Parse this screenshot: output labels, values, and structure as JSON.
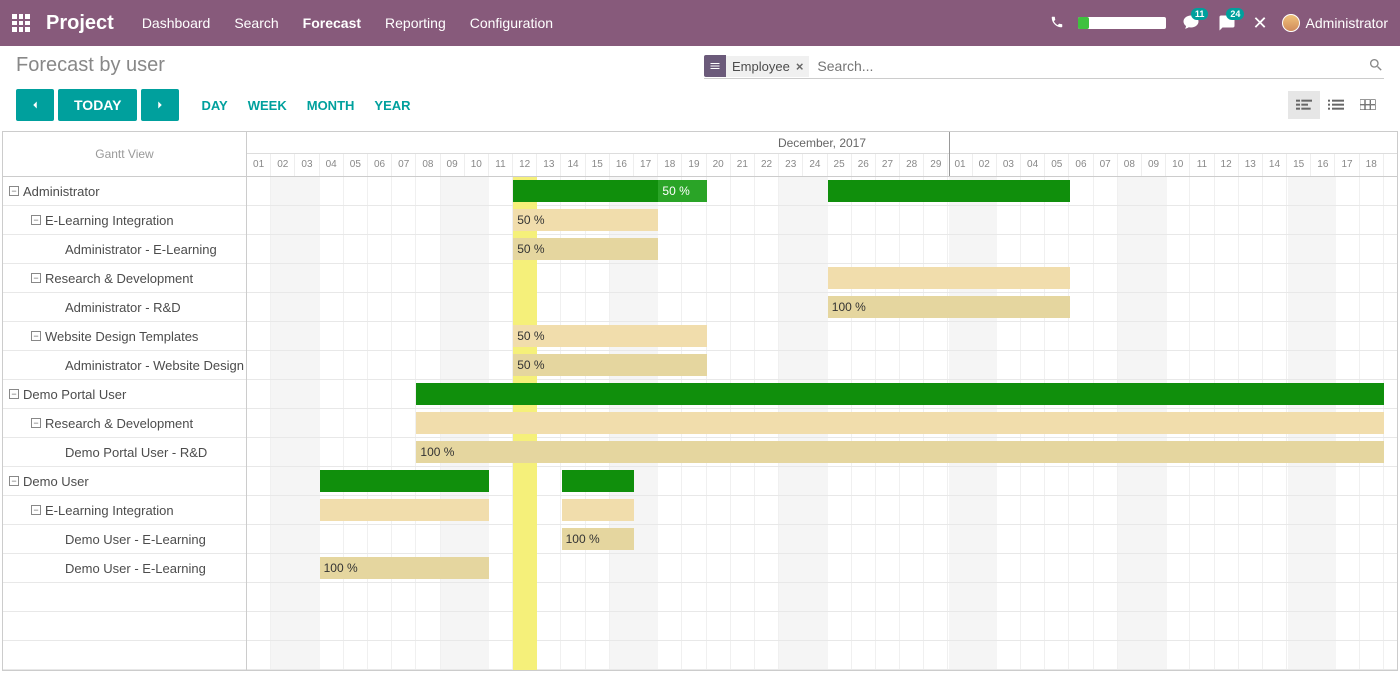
{
  "brand": "Project",
  "nav": [
    "Dashboard",
    "Search",
    "Forecast",
    "Reporting",
    "Configuration"
  ],
  "nav_active": 2,
  "badge_msg": "11",
  "badge_chat": "24",
  "username": "Administrator",
  "page_title": "Forecast by user",
  "search_facet": "Employee",
  "search_placeholder": "Search...",
  "toolbar": {
    "today": "TODAY"
  },
  "scales": [
    "DAY",
    "WEEK",
    "MONTH",
    "YEAR"
  ],
  "gantt_label": "Gantt View",
  "month_label": "December, 2017",
  "today_col": 11,
  "days": [
    "01",
    "02",
    "03",
    "04",
    "05",
    "06",
    "07",
    "08",
    "09",
    "10",
    "11",
    "12",
    "13",
    "14",
    "15",
    "16",
    "17",
    "18",
    "19",
    "20",
    "21",
    "22",
    "23",
    "24",
    "25",
    "26",
    "27",
    "28",
    "29",
    "01",
    "02",
    "03",
    "04",
    "05",
    "06",
    "07",
    "08",
    "09",
    "10",
    "11",
    "12",
    "13",
    "14",
    "15",
    "16",
    "17",
    "18"
  ],
  "month_split": 29,
  "weekends": [
    [
      1,
      2
    ],
    [
      8,
      9
    ],
    [
      15,
      16
    ],
    [
      22,
      23
    ],
    [
      29,
      30
    ],
    [
      36,
      37
    ],
    [
      43,
      44
    ]
  ],
  "rows": [
    {
      "label": "Administrator",
      "indent": 0,
      "toggle": true,
      "bars": [
        {
          "start": 11,
          "span": 6,
          "cls": "green"
        },
        {
          "start": 17,
          "span": 2,
          "cls": "green2",
          "text": "50 %"
        },
        {
          "start": 24,
          "span": 10,
          "cls": "green"
        }
      ]
    },
    {
      "label": "E-Learning Integration",
      "indent": 1,
      "toggle": true,
      "bars": [
        {
          "start": 11,
          "span": 6,
          "cls": "tan",
          "text": "50 %"
        }
      ]
    },
    {
      "label": "Administrator - E-Learning",
      "indent": 2,
      "bars": [
        {
          "start": 11,
          "span": 6,
          "cls": "ltan",
          "text": "50 %"
        }
      ]
    },
    {
      "label": "Research & Development",
      "indent": 1,
      "toggle": true,
      "bars": [
        {
          "start": 24,
          "span": 10,
          "cls": "tan"
        }
      ]
    },
    {
      "label": "Administrator - R&D",
      "indent": 2,
      "bars": [
        {
          "start": 24,
          "span": 10,
          "cls": "ltan",
          "text": "100 %"
        }
      ]
    },
    {
      "label": "Website Design Templates",
      "indent": 1,
      "toggle": true,
      "bars": [
        {
          "start": 11,
          "span": 8,
          "cls": "tan",
          "text": "50 %"
        }
      ]
    },
    {
      "label": "Administrator - Website Design",
      "indent": 2,
      "bars": [
        {
          "start": 11,
          "span": 8,
          "cls": "ltan",
          "text": "50 %"
        }
      ]
    },
    {
      "label": "Demo Portal User",
      "indent": 0,
      "toggle": true,
      "bars": [
        {
          "start": 7,
          "span": 40,
          "cls": "green"
        }
      ]
    },
    {
      "label": "Research & Development",
      "indent": 1,
      "toggle": true,
      "bars": [
        {
          "start": 7,
          "span": 40,
          "cls": "tan"
        }
      ]
    },
    {
      "label": "Demo Portal User - R&D",
      "indent": 2,
      "bars": [
        {
          "start": 7,
          "span": 40,
          "cls": "ltan",
          "text": "100 %"
        }
      ]
    },
    {
      "label": "Demo User",
      "indent": 0,
      "toggle": true,
      "bars": [
        {
          "start": 3,
          "span": 7,
          "cls": "green"
        },
        {
          "start": 13,
          "span": 3,
          "cls": "green"
        }
      ]
    },
    {
      "label": "E-Learning Integration",
      "indent": 1,
      "toggle": true,
      "bars": [
        {
          "start": 3,
          "span": 7,
          "cls": "tan"
        },
        {
          "start": 13,
          "span": 3,
          "cls": "tan"
        }
      ]
    },
    {
      "label": "Demo User - E-Learning",
      "indent": 2,
      "bars": [
        {
          "start": 13,
          "span": 3,
          "cls": "ltan",
          "text": "100 %"
        }
      ]
    },
    {
      "label": "Demo User - E-Learning",
      "indent": 2,
      "bars": [
        {
          "start": 3,
          "span": 7,
          "cls": "ltan",
          "text": "100 %"
        }
      ]
    },
    {
      "label": "",
      "indent": 0,
      "bars": []
    },
    {
      "label": "",
      "indent": 0,
      "bars": []
    },
    {
      "label": "",
      "indent": 0,
      "bars": []
    }
  ]
}
